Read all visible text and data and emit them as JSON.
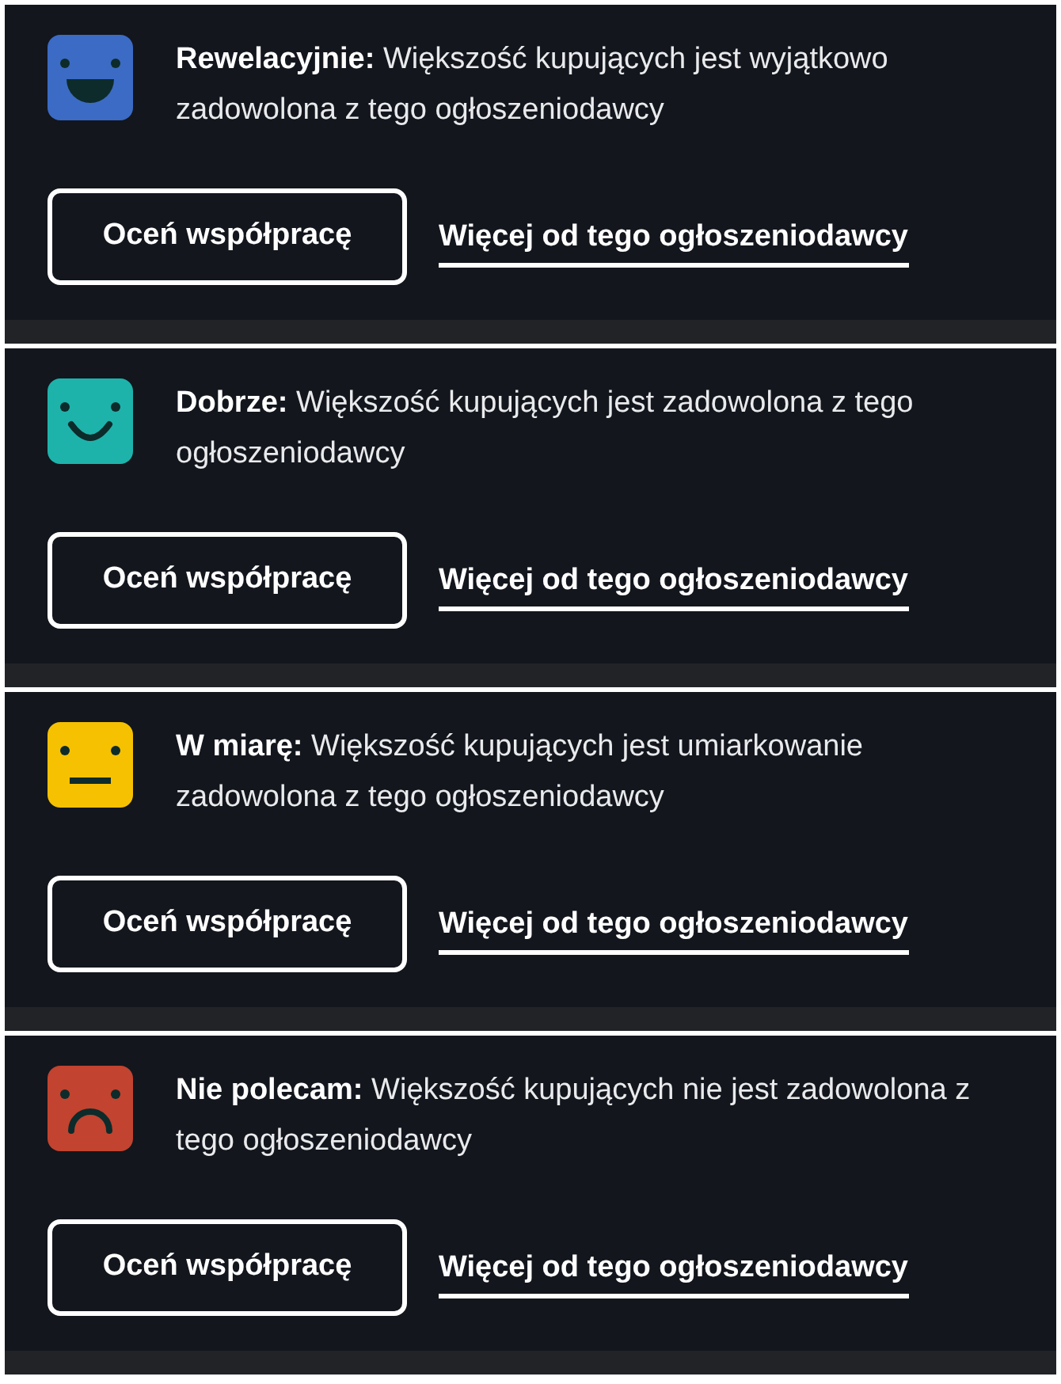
{
  "cards": [
    {
      "kind": "great",
      "color": "#3b6bc4",
      "text": "**Rewelacyjnie:** Większość kupujących jest wyjątkowo zadowolona z tego ogłoszeniodawcy",
      "rate_button": "Oceń współpracę",
      "more_link": "Więcej od tego ogłoszeniodawcy"
    },
    {
      "kind": "good",
      "color": "#1db3ab",
      "text": "**Dobrze:** Większość kupujących jest zadowolona z tego ogłoszeniodawcy",
      "rate_button": "Oceń współpracę",
      "more_link": "Więcej od tego ogłoszeniodawcy"
    },
    {
      "kind": "neutral",
      "color": "#f6c100",
      "text": "**W miarę:** Większość kupujących jest umiarkowanie zadowolona z tego ogłoszeniodawcy",
      "rate_button": "Oceń współpracę",
      "more_link": "Więcej od tego ogłoszeniodawcy"
    },
    {
      "kind": "bad",
      "color": "#c2432f",
      "text": "**Nie polecam:** Większość kupujących nie jest zadowolona z tego ogłoszeniodawcy",
      "rate_button": "Oceń współpracę",
      "more_link": "Więcej od tego ogłoszeniodawcy"
    }
  ]
}
